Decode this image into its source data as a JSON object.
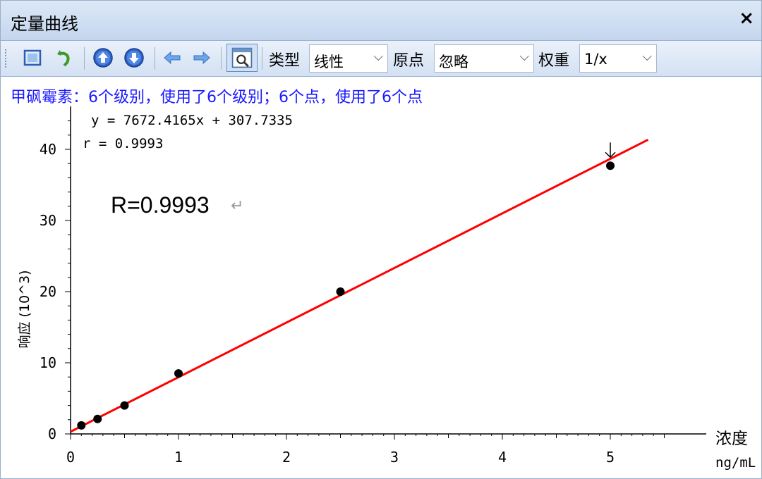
{
  "window": {
    "title": "定量曲线",
    "close_label": "×"
  },
  "toolbar": {
    "buttons": [
      {
        "name": "fit-view-icon"
      },
      {
        "name": "undo-icon"
      },
      {
        "name": "move-up-icon"
      },
      {
        "name": "move-down-icon"
      },
      {
        "name": "previous-icon"
      },
      {
        "name": "next-icon"
      },
      {
        "name": "zoom-view-icon"
      }
    ],
    "type_label": "类型",
    "type_value": "线性",
    "origin_label": "原点",
    "origin_value": "忽略",
    "weight_label": "权重",
    "weight_value": "1/x"
  },
  "chart_data": {
    "type": "scatter",
    "title": "甲砜霉素：6个级别，使用了6个级别；6个点，使用了6个点",
    "equation": "y = 7672.4165x + 307.7335",
    "r_text": "r = 0.9993",
    "annotation": "R=0.9993",
    "ylabel": "响应 (10^3)",
    "xlabel_top": "浓度",
    "xlabel_bottom": "ng/mL",
    "xlim": [
      0,
      5.5
    ],
    "ylim": [
      0,
      46
    ],
    "x_ticks": [
      0,
      1,
      2,
      3,
      4,
      5
    ],
    "y_ticks": [
      0,
      10,
      20,
      30,
      40
    ],
    "slope_k": 7.6724165,
    "intercept_k": 0.3077335,
    "fit_x_range": [
      0,
      5.35
    ],
    "fit_color": "#ff0000",
    "title_color": "#1a1aff",
    "points": [
      {
        "x": 0.1,
        "y": 1.2
      },
      {
        "x": 0.25,
        "y": 2.1
      },
      {
        "x": 0.5,
        "y": 4.0
      },
      {
        "x": 1.0,
        "y": 8.5
      },
      {
        "x": 2.5,
        "y": 20.0
      },
      {
        "x": 5.0,
        "y": 37.7
      }
    ],
    "marked_point": {
      "x": 5.0,
      "y": 37.7
    }
  }
}
